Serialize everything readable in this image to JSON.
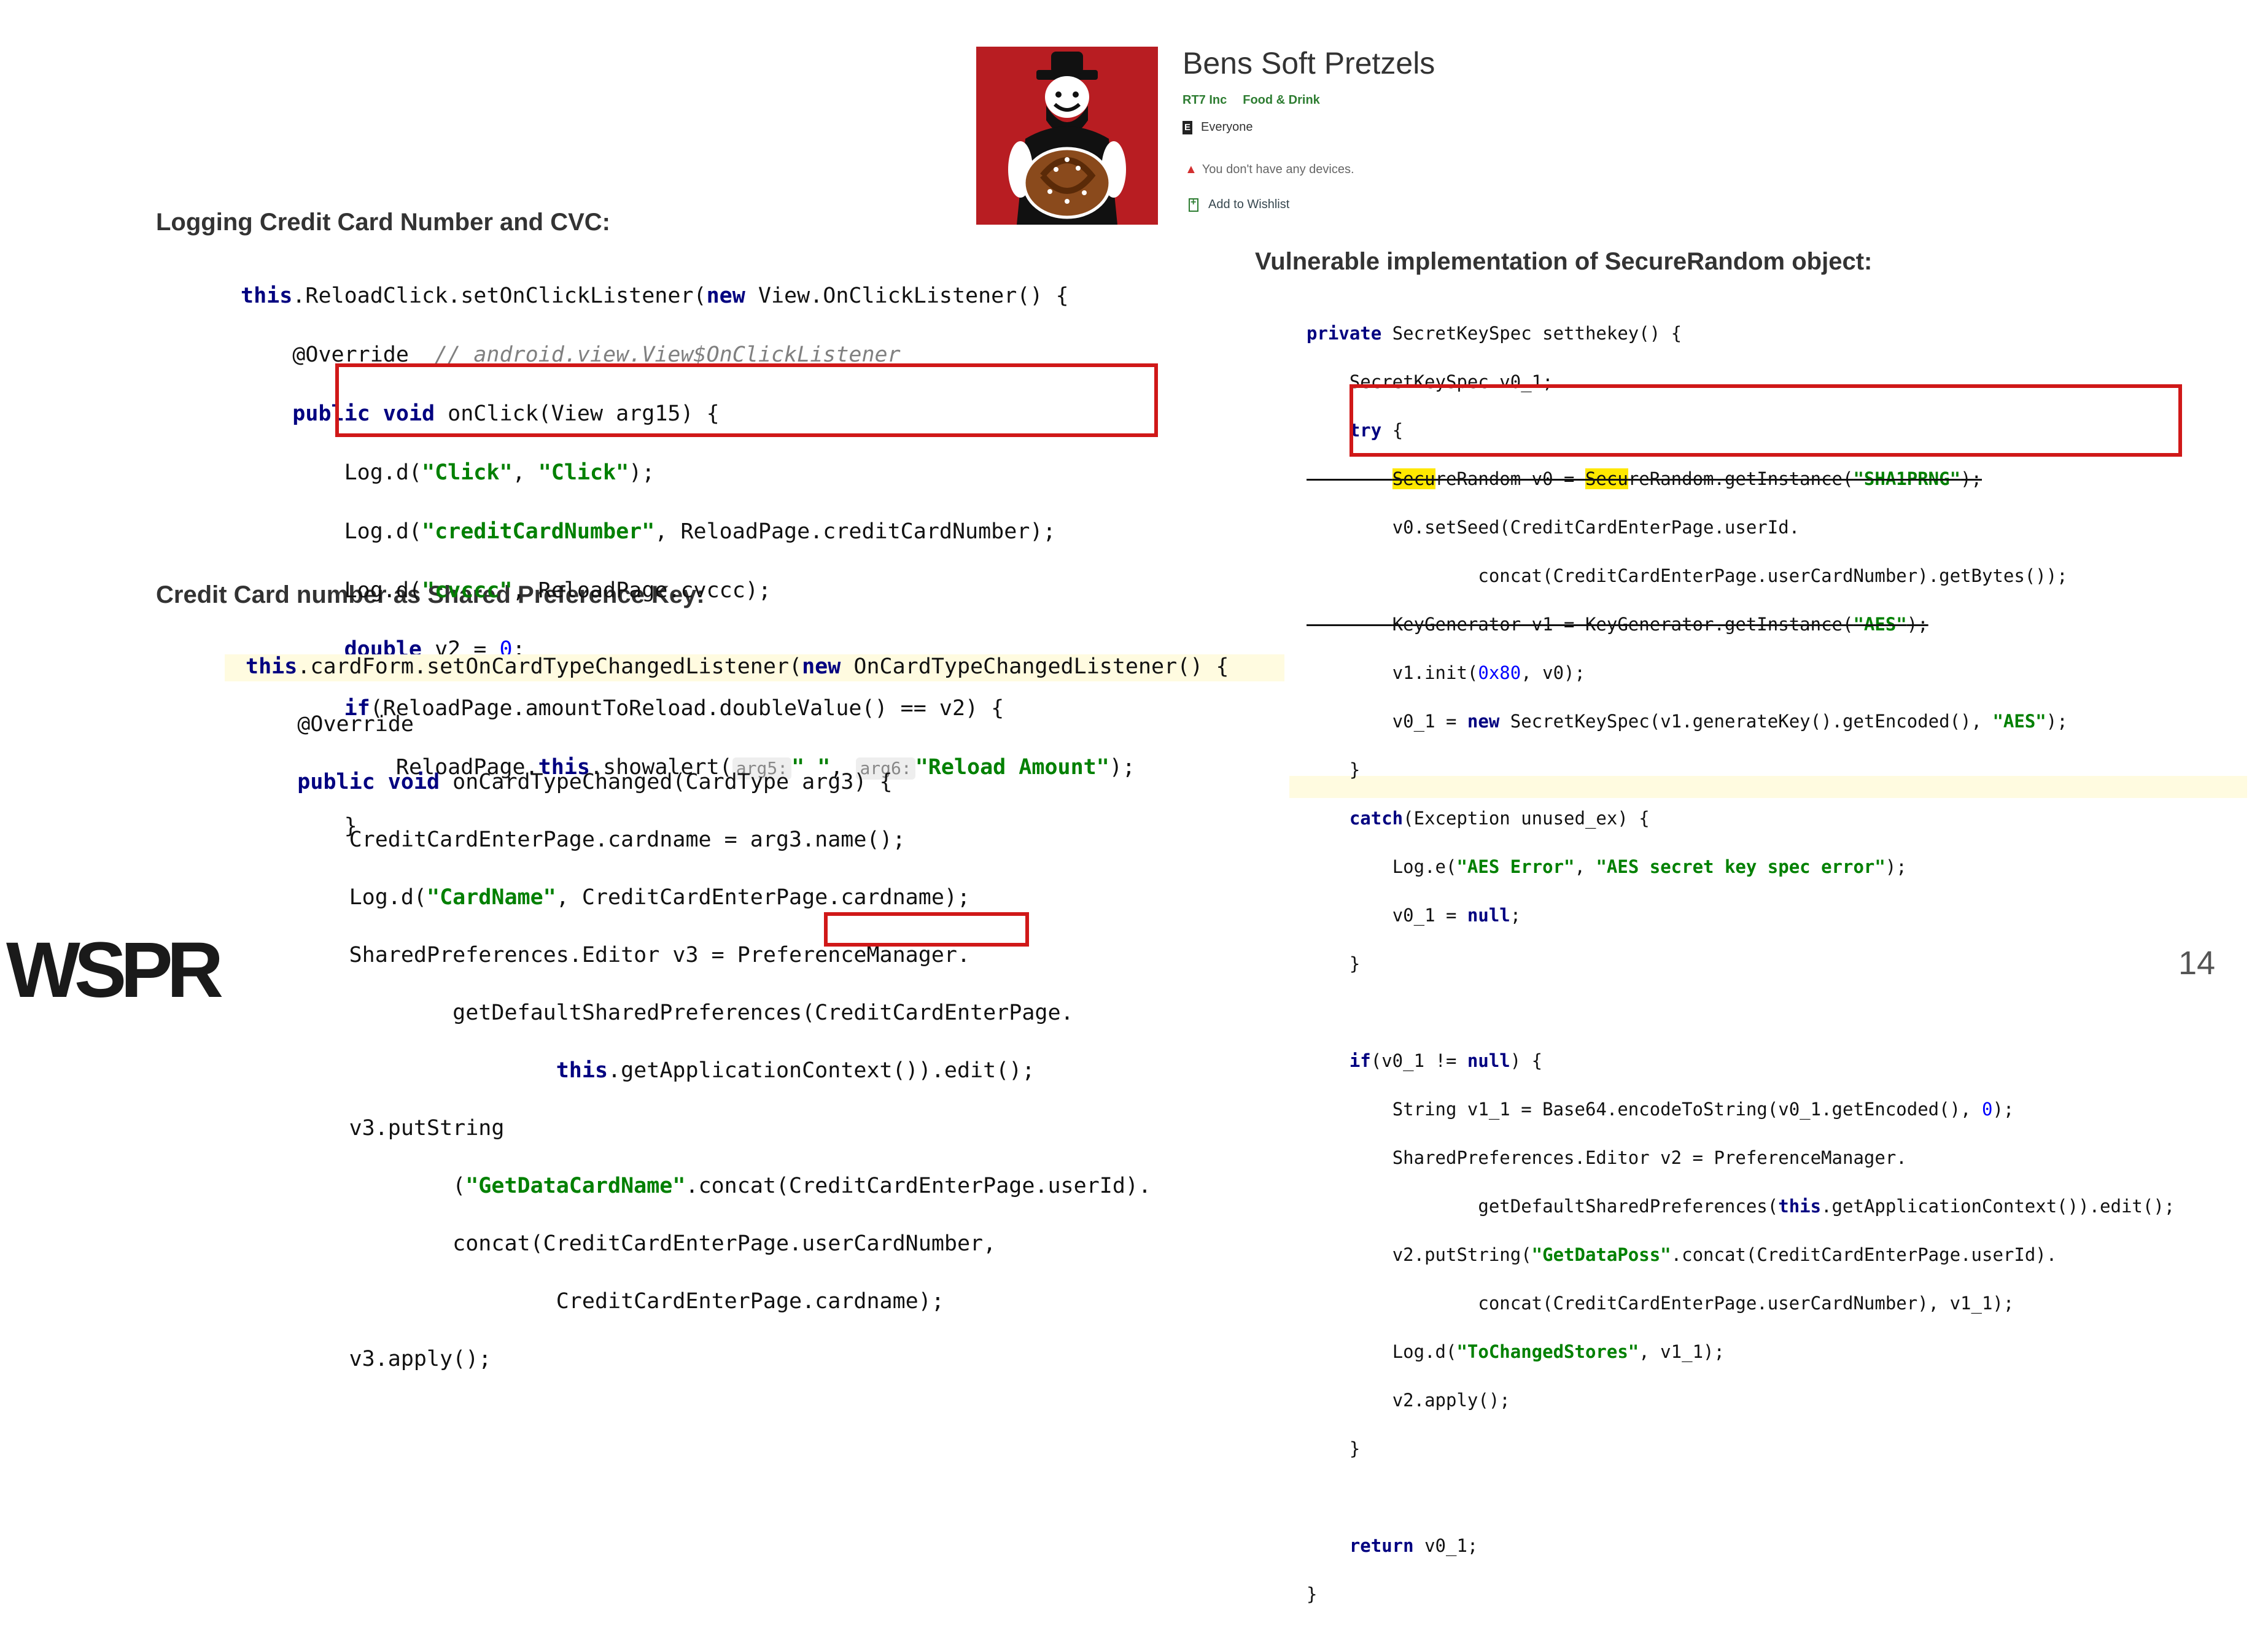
{
  "app": {
    "title": "Bens Soft Pretzels",
    "developer": "RT7 Inc",
    "category": "Food & Drink",
    "rating_badge": "E",
    "rating": "Everyone",
    "warning": "You don't have any devices.",
    "wishlist": "Add to Wishlist"
  },
  "sections": {
    "logging_heading": "Logging Credit Card Number and CVC:",
    "shared_pref_heading": "Credit Card number as Shared Preference Key:",
    "securerandom_heading": "Vulnerable implementation of  SecureRandom object:"
  },
  "code1": {
    "l1a": "this",
    "l1b": ".ReloadClick.setOnClickListener(",
    "l1c": "new",
    "l1d": " View.OnClickListener() {",
    "l2a": "@Override",
    "l2b": "// android.view.View$OnClickListener",
    "l3a": "public void",
    "l3b": " onClick(View arg15) {",
    "l4a": "Log.d(",
    "l4b": "\"Click\"",
    "l4c": ", ",
    "l4d": "\"Click\"",
    "l4e": ");",
    "l5a": "Log.d(",
    "l5b": "\"creditCardNumber\"",
    "l5c": ", ReloadPage.creditCardNumber);",
    "l6a": "Log.d(",
    "l6b": "\"cvccc\"",
    "l6c": ", ReloadPage.cvccc);",
    "l7a": "double",
    "l7b": " v2 = ",
    "l7c": "0",
    "l7d": ";",
    "l8a": "if",
    "l8b": "(ReloadPage.amountToReload.doubleValue() == v2) {",
    "l9a": "ReloadPage.",
    "l9b": "this",
    "l9c": ".showalert(",
    "l9d": "arg5:",
    "l9e": "\" \"",
    "l9f": ", ",
    "l9g": "arg6:",
    "l9h": "\"Reload Amount\"",
    "l9i": ");",
    "l10a": "}"
  },
  "code2": {
    "l1a": "this",
    "l1b": ".cardForm.setOnCardTypeChangedListener(",
    "l1c": "new",
    "l1d": " OnCardTypeChangedListener() {",
    "l2a": "@Override",
    "l3a": "public void",
    "l3b": " onCardTypeChanged(CardType arg3) {",
    "l4a": "CreditCardEnterPage.cardname = arg3.name();",
    "l5a": "Log.d(",
    "l5b": "\"CardName\"",
    "l5c": ", CreditCardEnterPage.cardname);",
    "l6a": "SharedPreferences.Editor v3 = PreferenceManager.",
    "l7a": "getDefaultSharedPreferences(CreditCardEnterPage.",
    "l8a": "this",
    "l8b": ".getApplicationContext()).edit();",
    "l9a": "v3.putString",
    "l10a": "(",
    "l10b": "\"GetDataCardName\"",
    "l10c": ".concat(CreditCardEnterPage.userId).",
    "l11a": "concat(CreditCardEnterPage.",
    "l11b": "userCardNumber",
    "l11c": ",",
    "l12a": "CreditCardEnterPage.cardname);",
    "l13a": "v3.apply();"
  },
  "code3": {
    "l1a": "private",
    "l1b": " SecretKeySpec setthekey() {",
    "l2a": "SecretKeySpec v0_1;",
    "l3a": "try",
    "l3b": " {",
    "l4a": "Secu",
    "l4b": "reRandom v0 = ",
    "l4c": "Secu",
    "l4d": "reRandom.getInstance(",
    "l4e": "\"SHA1PRNG\"",
    "l4f": ");",
    "l5a": "v0.setSeed(CreditCardEnterPage.userId.",
    "l6a": "concat(CreditCardEnterPage.userCardNumber).getBytes());",
    "l7a": "KeyGenerator v1 = KeyGenerator.getInstance(",
    "l7b": "\"AES\"",
    "l7c": ");",
    "l8a": "v1.init(",
    "l8b": "0x80",
    "l8c": ", v0);",
    "l9a": "v0_1 = ",
    "l9b": "new",
    "l9c": " SecretKeySpec(v1.generateKey().getEncoded(), ",
    "l9d": "\"AES\"",
    "l9e": ");",
    "l10a": "}",
    "l11a": "catch",
    "l11b": "(Exception unused_ex) {",
    "l12a": "Log.e(",
    "l12b": "\"AES Error\"",
    "l12c": ", ",
    "l12d": "\"AES secret key spec error\"",
    "l12e": ");",
    "l13a": "v0_1 = ",
    "l13b": "null",
    "l13c": ";",
    "l14a": "}",
    "l16a": "if",
    "l16b": "(v0_1 != ",
    "l16c": "null",
    "l16d": ") {",
    "l17a": "String v1_1 = Base64.encodeToString(v0_1.getEncoded(), ",
    "l17b": "0",
    "l17c": ");",
    "l18a": "SharedPreferences.Editor v2 = PreferenceManager.",
    "l19a": "getDefaultSharedPreferences(",
    "l19b": "this",
    "l19c": ".getApplicationContext()).edit();",
    "l20a": "v2.putString(",
    "l20b": "\"GetDataPoss\"",
    "l20c": ".concat(CreditCardEnterPage.userId).",
    "l21a": "concat(CreditCardEnterPage.userCardNumber), v1_1);",
    "l22a": "Log.d(",
    "l22b": "\"ToChangedStores\"",
    "l22c": ", v1_1);",
    "l23a": "v2.apply();",
    "l24a": "}",
    "l26a": "return",
    "l26b": " v0_1;",
    "l27a": "}"
  },
  "footer": {
    "logo": "WSPR",
    "page_number": "14"
  },
  "colors": {
    "keyword": "#000080",
    "string": "#008000",
    "number": "#0000ff",
    "highlight_box": "#d01818",
    "app_icon_bg": "#b81d22"
  }
}
